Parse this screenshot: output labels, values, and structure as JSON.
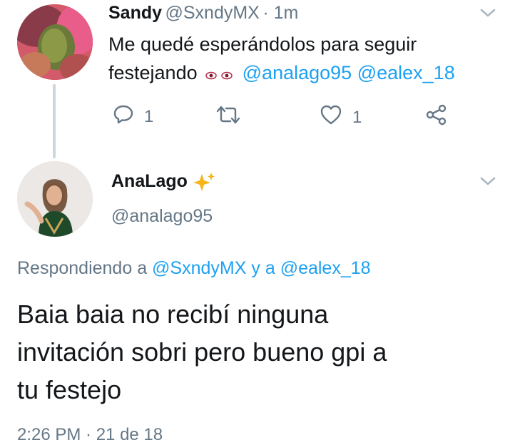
{
  "tweet1": {
    "name": "Sandy",
    "handle": "@SxndyMX",
    "time": "· 1m",
    "text_line1": "Me quedé esperándolos para seguir",
    "text_line2": "festejando",
    "mention1": "@analago95",
    "mention2": "@ealex_18",
    "reply_count": "1",
    "like_count": "1"
  },
  "tweet2": {
    "name": "AnaLago",
    "handle": "@analago95",
    "replying_prefix": "Respondiendo a",
    "replying_user1": "@SxndyMX",
    "replying_join": "y a",
    "replying_user2": "@ealex_18",
    "text_line1": "Baia baia no recibí ninguna",
    "text_line2": "invitación sobri pero bueno gpi a",
    "text_line3": "tu festejo",
    "meta_partial": "2:26 PM · 21 de 18"
  },
  "colors": {
    "link": "#1da1f2",
    "muted": "#657786",
    "text": "#14171a",
    "line": "#ccd6dd"
  }
}
